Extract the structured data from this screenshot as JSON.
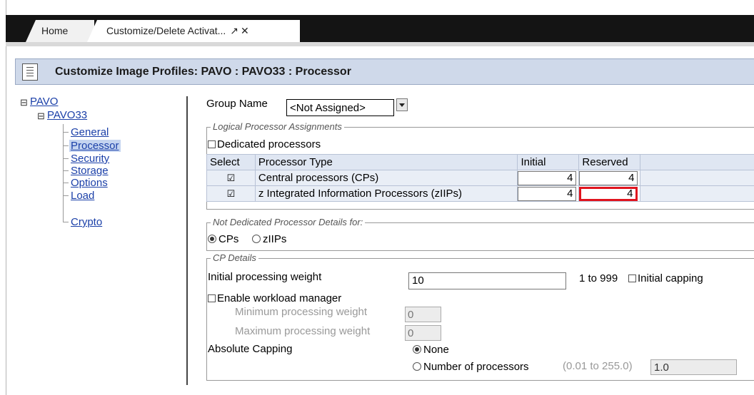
{
  "tabs": [
    {
      "label": "Home"
    },
    {
      "label": "Customize/Delete Activat..."
    }
  ],
  "header": {
    "title": "Customize Image Profiles: PAVO : PAVO33 : Processor"
  },
  "tree": {
    "root": "PAVO",
    "child": "PAVO33",
    "items": [
      "General",
      "Processor",
      "Security",
      "Storage",
      "Options",
      "Load",
      "Crypto"
    ],
    "selected": "Processor"
  },
  "group": {
    "label": "Group Name",
    "value": "<Not Assigned>"
  },
  "logical": {
    "legend": "Logical Processor Assignments",
    "dedicated_label": "Dedicated processors",
    "dedicated_checked": false,
    "columns": [
      "Select",
      "Processor Type",
      "Initial",
      "Reserved"
    ],
    "rows": [
      {
        "selected": true,
        "type": "Central processors (CPs)",
        "initial": "4",
        "reserved": "4"
      },
      {
        "selected": true,
        "type": "z Integrated Information Processors (zIIPs)",
        "initial": "4",
        "reserved": "4"
      }
    ]
  },
  "not_dedicated": {
    "legend": "Not Dedicated Processor Details for:",
    "options": [
      "CPs",
      "zIIPs"
    ],
    "selected": "CPs"
  },
  "cp_details": {
    "legend": "CP Details",
    "initial_weight_label": "Initial processing weight",
    "initial_weight": "10",
    "range": "1 to 999",
    "initial_capping_label": "Initial capping",
    "enable_wlm_label": "Enable workload manager",
    "min_weight_label": "Minimum processing weight",
    "min_weight": "0",
    "max_weight_label": "Maximum processing weight",
    "max_weight": "0",
    "absolute_capping_label": "Absolute Capping",
    "capping_options": [
      "None",
      "Number of processors"
    ],
    "capping_selected": "None",
    "processors_range": "(0.01 to 255.0)",
    "processors_value": "1.0"
  },
  "colors": {
    "highlight": "#e0141e",
    "header_bg": "#cfd9ea",
    "tab_bar": "#141414",
    "link": "#1a3fa8"
  }
}
